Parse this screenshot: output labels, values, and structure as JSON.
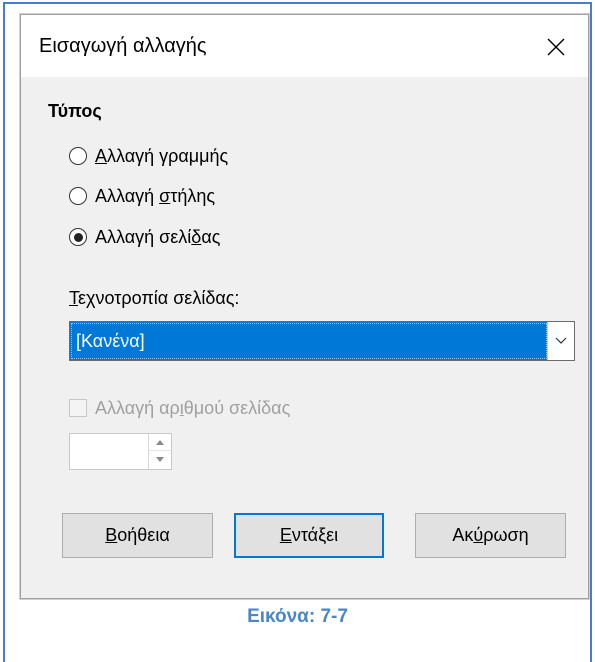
{
  "dialog": {
    "title": "Εισαγωγή αλλαγής",
    "type_label": "Τύπος",
    "options": [
      {
        "pre": "",
        "acc": "Α",
        "post": "λλαγή γραμμής",
        "checked": false
      },
      {
        "pre": "Αλλαγή ",
        "acc": "σ",
        "post": "τήλης",
        "checked": false
      },
      {
        "pre": "Αλλαγή σελί",
        "acc": "δ",
        "post": "ας",
        "checked": true
      }
    ],
    "style_label": {
      "acc": "Τ",
      "post": "εχνοτροπία σελίδας:"
    },
    "style_value": "[Κανένα]",
    "page_number_change": {
      "pre": "Αλλαγή αρ",
      "acc": "ι",
      "post": "θμού σελίδας",
      "checked": false,
      "enabled": false
    },
    "page_number_value": "",
    "buttons": {
      "help": {
        "acc": "Β",
        "post": "οήθεια"
      },
      "ok": {
        "acc": "Ε",
        "post": "ντάξει"
      },
      "cancel": {
        "pre": "Ακ",
        "acc": "ύ",
        "post": "ρωση"
      }
    }
  },
  "caption": "Εικόνα: 7-7",
  "colors": {
    "accent": "#0078d7",
    "frame": "#4a7bd0",
    "caption": "#4a86c8"
  }
}
